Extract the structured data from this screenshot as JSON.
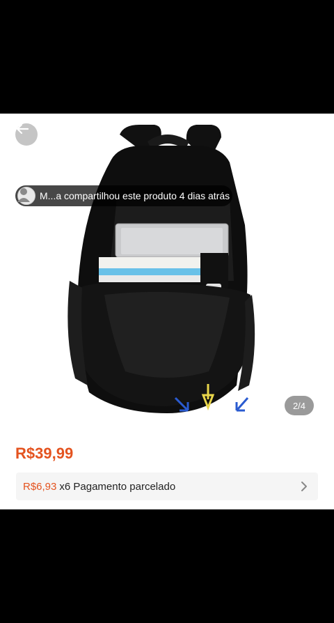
{
  "product": {
    "share_banner": "M...a compartilhou este produto 4 dias atrás",
    "image_counter": "2/4",
    "price": "R$39,99",
    "installment": {
      "amount": "R$6,93",
      "text": "x6 Pagamento parcelado"
    }
  },
  "icons": {
    "back": "arrow-left-icon",
    "chevron": "chevron-right-icon",
    "avatar": "user-avatar"
  },
  "colors": {
    "accent": "#e4531f",
    "banner_bg": "#000000",
    "row_bg": "#f5f5f5"
  }
}
